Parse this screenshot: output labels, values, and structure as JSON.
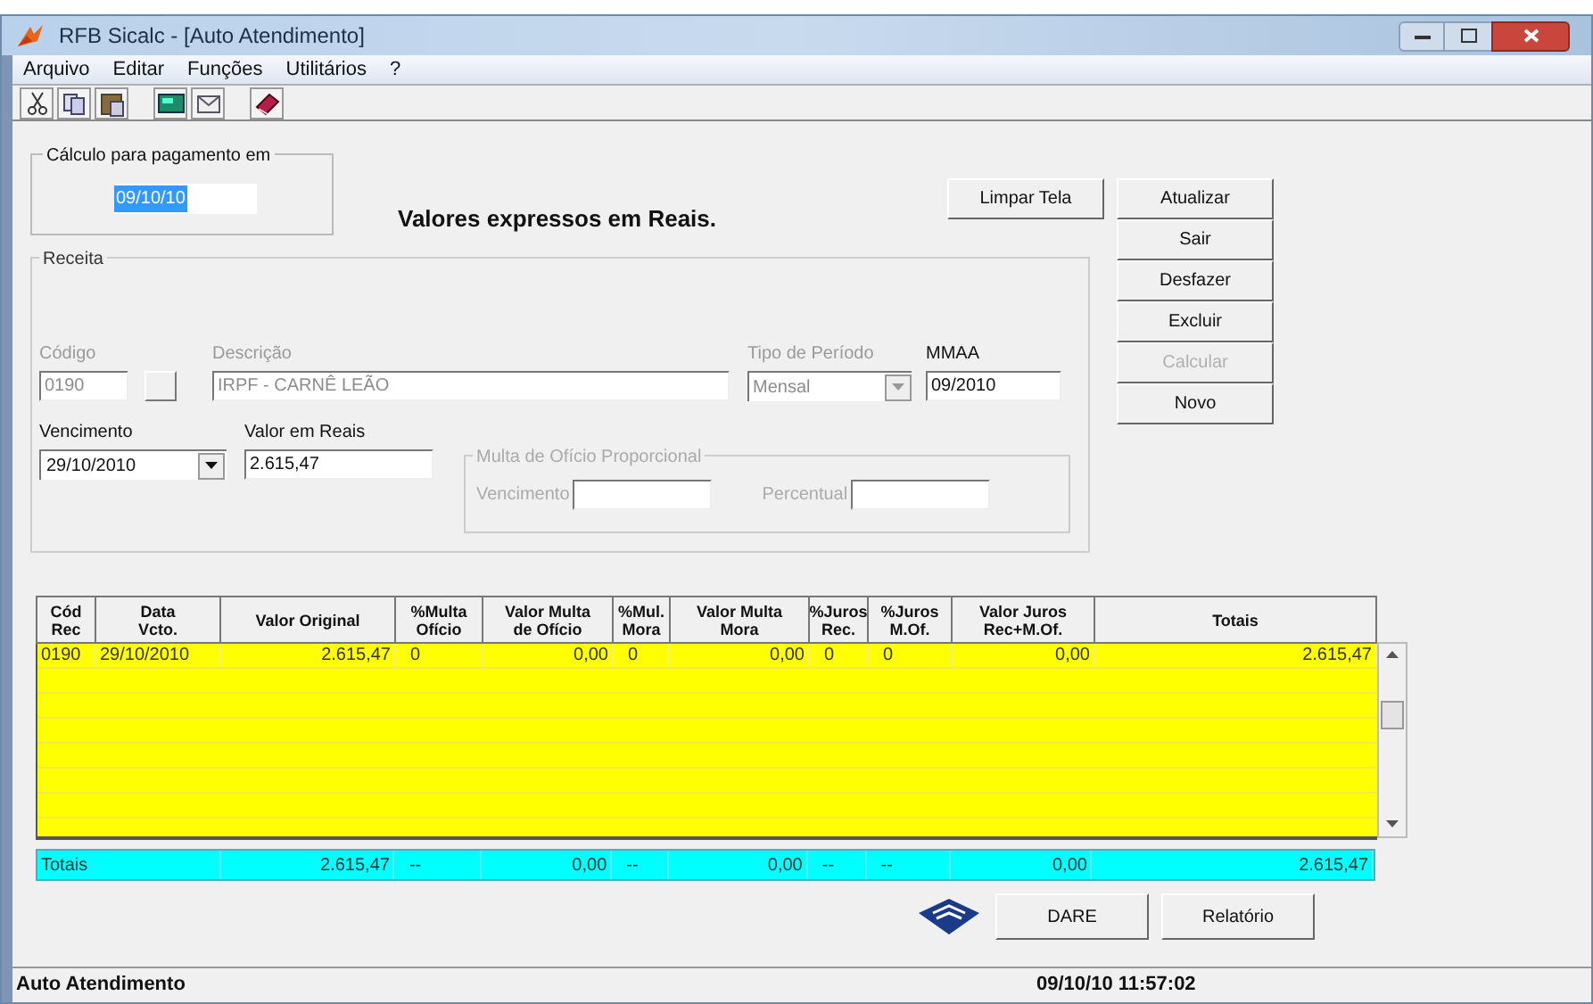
{
  "window": {
    "title": "RFB  Sicalc   - [Auto Atendimento]"
  },
  "menu": [
    {
      "label": "Arquivo"
    },
    {
      "label": "Editar"
    },
    {
      "label": "Funções"
    },
    {
      "label": "Utilitários"
    },
    {
      "label": "?"
    }
  ],
  "payment_date": {
    "legend": "Cálculo para pagamento em",
    "value": "09/10/10",
    "selected": true
  },
  "notice": "Valores expressos em Reais.",
  "clear_button": {
    "label": "Limpar Tela"
  },
  "side_buttons": [
    {
      "label": "Atualizar",
      "disabled": false
    },
    {
      "label": "Sair",
      "disabled": false
    },
    {
      "label": "Desfazer",
      "disabled": false
    },
    {
      "label": "Excluir",
      "disabled": false
    },
    {
      "label": "Calcular",
      "disabled": true
    },
    {
      "label": "Novo",
      "disabled": false
    }
  ],
  "receita": {
    "legend": "Receita",
    "codigo": {
      "label": "Código",
      "value": "0190",
      "disabled": true
    },
    "descricao": {
      "label": "Descrição",
      "value": "IRPF - CARNÊ LEÃO",
      "disabled": true
    },
    "tipo_periodo": {
      "label": "Tipo de Período",
      "value": "Mensal",
      "disabled": true
    },
    "mmaa": {
      "label": "MMAA",
      "value": "09/2010",
      "disabled": false
    },
    "vencimento": {
      "label": "Vencimento",
      "value": "29/10/2010",
      "disabled": false
    },
    "valor": {
      "label": "Valor em Reais",
      "value": "2.615,47",
      "disabled": false
    },
    "multa": {
      "legend": "Multa de Ofício Proporcional",
      "disabled": true,
      "vencimento_label": "Vencimento",
      "percentual_label": "Percentual"
    }
  },
  "grid": {
    "columns": [
      {
        "label": "Cód\nRec",
        "kind": "text"
      },
      {
        "label": "Data\nVcto.",
        "kind": "text"
      },
      {
        "label": "Valor Original",
        "kind": "number"
      },
      {
        "label": "%Multa\nOfício",
        "kind": "percent"
      },
      {
        "label": "Valor Multa\nde Ofício",
        "kind": "number"
      },
      {
        "label": "%Mul.\nMora",
        "kind": "percent"
      },
      {
        "label": "Valor Multa\nMora",
        "kind": "number"
      },
      {
        "label": "%Juros\nRec.",
        "kind": "percent"
      },
      {
        "label": "%Juros\nM.Of.",
        "kind": "percent"
      },
      {
        "label": "Valor Juros\nRec+M.Of.",
        "kind": "number"
      },
      {
        "label": "Totais",
        "kind": "number"
      }
    ],
    "rows": [
      [
        "0190",
        "29/10/2010",
        "2.615,47",
        "0",
        "0,00",
        "0",
        "0,00",
        "0",
        "0",
        "0,00",
        "2.615,47"
      ]
    ],
    "totals": [
      "Totais",
      "2.615,47",
      "--",
      "0,00",
      "--",
      "0,00",
      "--",
      "--",
      "0,00",
      "2.615,47"
    ]
  },
  "bottom_buttons": [
    {
      "label": "DARE"
    },
    {
      "label": "Relatório"
    }
  ],
  "status_bar": {
    "left": "Auto Atendimento",
    "right": "09/10/10 11:57:02"
  }
}
